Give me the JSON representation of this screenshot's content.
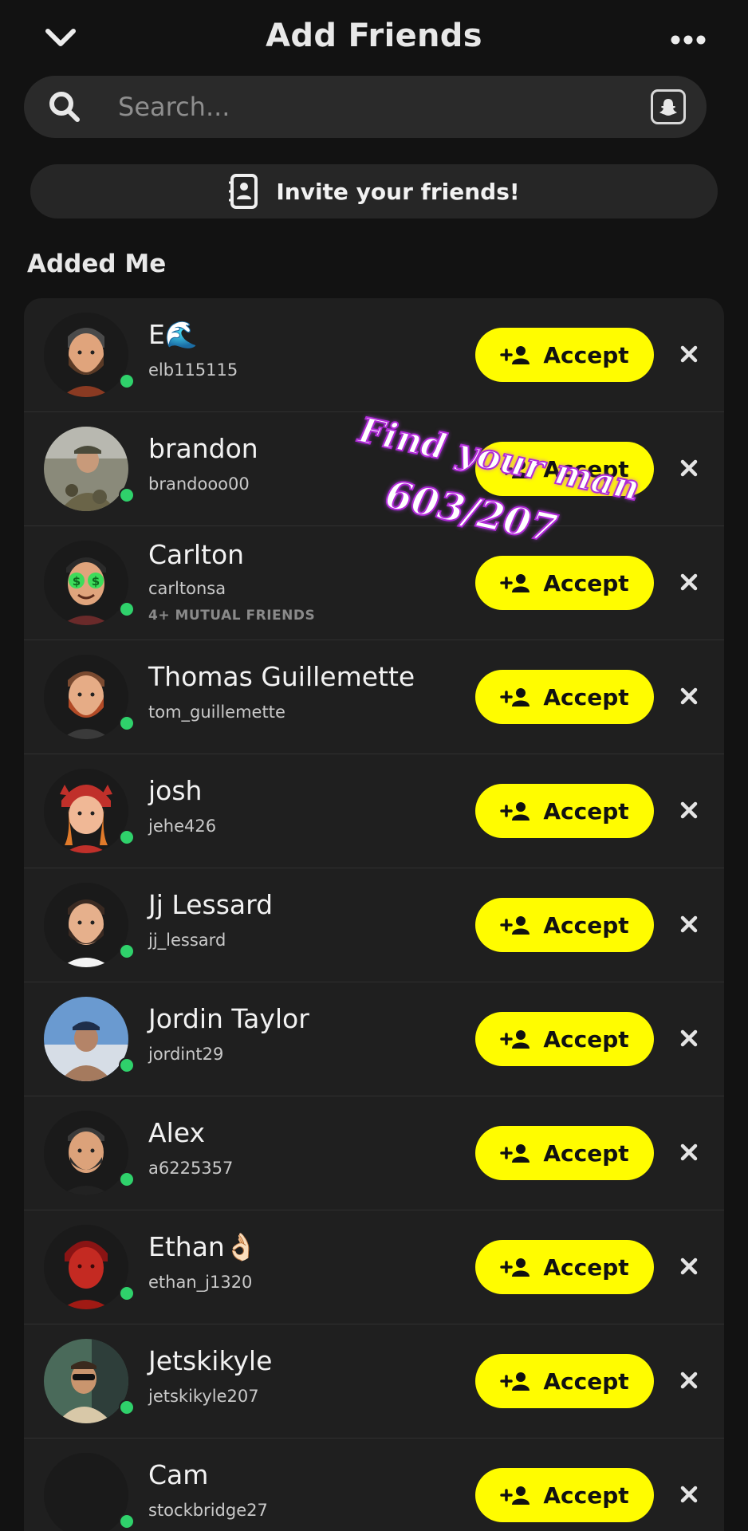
{
  "header": {
    "title": "Add Friends",
    "back_icon": "chevron-down-icon",
    "more_icon": "more-dots-icon"
  },
  "search": {
    "placeholder": "Search...",
    "value": "",
    "icon": "search-icon",
    "action_icon": "snapcode-icon"
  },
  "invite": {
    "label": "Invite your friends!",
    "icon": "contacts-icon"
  },
  "section": {
    "title": "Added Me"
  },
  "requests": [
    {
      "name": "E🌊",
      "username": "elb115115",
      "mutual": "",
      "online": true,
      "avatar": "bitmoji-bearded-man"
    },
    {
      "name": "brandon",
      "username": "brandooo00",
      "mutual": "",
      "online": true,
      "avatar": "photo-camo-outdoors"
    },
    {
      "name": "Carlton",
      "username": "carltonsa",
      "mutual": "4+ MUTUAL FRIENDS",
      "online": true,
      "avatar": "bitmoji-money-eyes"
    },
    {
      "name": "Thomas Guillemette",
      "username": "tom_guillemette",
      "mutual": "",
      "online": true,
      "avatar": "bitmoji-red-beard"
    },
    {
      "name": "josh",
      "username": "jehe426",
      "mutual": "",
      "online": true,
      "avatar": "bitmoji-dragon-hat"
    },
    {
      "name": "Jj Lessard",
      "username": "jj_lessard",
      "mutual": "",
      "online": true,
      "avatar": "bitmoji-dark-beard"
    },
    {
      "name": "Jordin Taylor",
      "username": "jordint29",
      "mutual": "",
      "online": true,
      "avatar": "photo-sky-selfie"
    },
    {
      "name": "Alex",
      "username": "a6225357",
      "mutual": "",
      "online": true,
      "avatar": "bitmoji-short-beard"
    },
    {
      "name": "Ethan👌🏻",
      "username": "ethan_j1320",
      "mutual": "",
      "online": true,
      "avatar": "bitmoji-red-tint"
    },
    {
      "name": "Jetskikyle",
      "username": "jetskikyle207",
      "mutual": "",
      "online": true,
      "avatar": "photo-sunglasses"
    },
    {
      "name": "Cam",
      "username": "stockbridge27",
      "mutual": "",
      "online": true,
      "avatar": "blank-dark"
    }
  ],
  "accept_label": "Accept",
  "accept_icon": "add-friend-icon",
  "dismiss_icon": "close-icon",
  "overlay": {
    "line1": "Find your man",
    "line2": "603/207"
  },
  "colors": {
    "accent_yellow": "#fffc00",
    "online_green": "#2fd16b",
    "background": "#121212",
    "card": "#1f1f1f",
    "overlay_purple": "#b12ad8"
  }
}
